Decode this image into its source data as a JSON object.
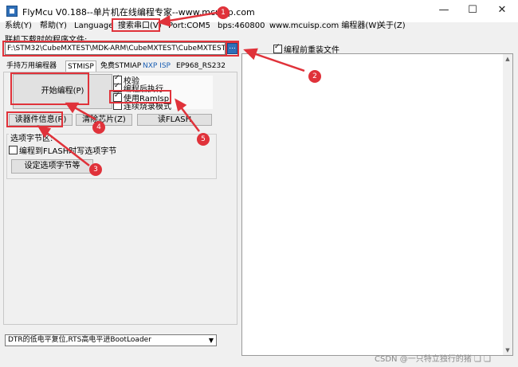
{
  "window": {
    "title": "FlyMcu V0.188--单片机在线编程专家--www.mcuisp.com",
    "minimize": "—",
    "maximize": "☐",
    "close": "✕"
  },
  "menu": [
    "系统(Y)",
    "帮助(Y)",
    "Language",
    "搜索串口(V)",
    "Port:COM5",
    "bps:460800",
    "www.mcuisp.com 编程器(W)",
    "关于(Z)"
  ],
  "file": {
    "label": "联机下载时的程序文件:",
    "path": "F:\\STM32\\CubeMXTEST\\MDK-ARM\\CubeMXTEST\\CubeMXTEST.hex",
    "browse": "...",
    "reload_label": "编程前重装文件"
  },
  "tabs": [
    "手持万用编程器",
    "STMISP",
    "免费STMIAP",
    "NXP ISP",
    "EP968_RS232"
  ],
  "panel": {
    "start_button": "开始编程(P)",
    "options": [
      {
        "label": "校验",
        "checked": true
      },
      {
        "label": "编程后执行",
        "checked": true
      },
      {
        "label": "使用RamIsp",
        "checked": true
      },
      {
        "label": "连续烧录模式",
        "checked": false
      }
    ],
    "read_info_button": "读器件信息(R)",
    "erase_button": "清除芯片(Z)",
    "read_flash_button": "读FLASH",
    "option_group_title": "选项字节区:",
    "write_option_label": "编程到FLASH时写选项字节",
    "set_option_button": "设定选项字节等"
  },
  "boot_select": "DTR的低电平复位,RTS高电平进BootLoader",
  "watermark": "CSDN @一只特立独行的猪 ❏ ❏",
  "annotations": [
    "1",
    "2",
    "3",
    "4",
    "5"
  ],
  "colors": {
    "annotation": "#e0323a",
    "link_blue": "#1a5fb4"
  }
}
